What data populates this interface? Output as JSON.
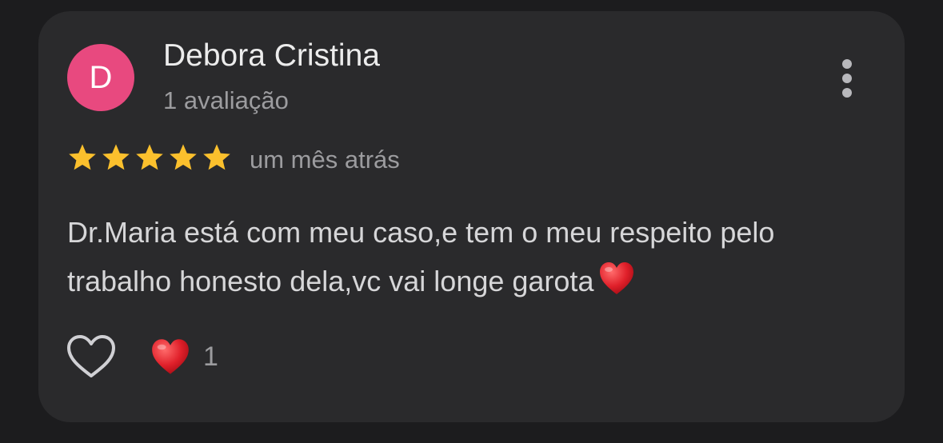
{
  "review": {
    "avatar_letter": "D",
    "avatar_color": "#e8497f",
    "author_name": "Debora Cristina",
    "author_reviews": "1 avaliação",
    "rating": 5,
    "rating_max": 5,
    "date": "um mês atrás",
    "text": "Dr.Maria está com meu caso,e tem o meu respeito pelo trabalho honesto dela,vc vai longe garota",
    "text_emoji_icon": "red-heart-emoji",
    "menu_icon": "more-vertical-icon"
  },
  "actions": {
    "like_icon": "heart-outline-icon",
    "reaction_icon": "red-heart-emoji",
    "reaction_count": "1"
  },
  "colors": {
    "background": "#1c1c1e",
    "card": "#2a2a2c",
    "star": "#fbc02d",
    "heart": "#e0202a"
  }
}
